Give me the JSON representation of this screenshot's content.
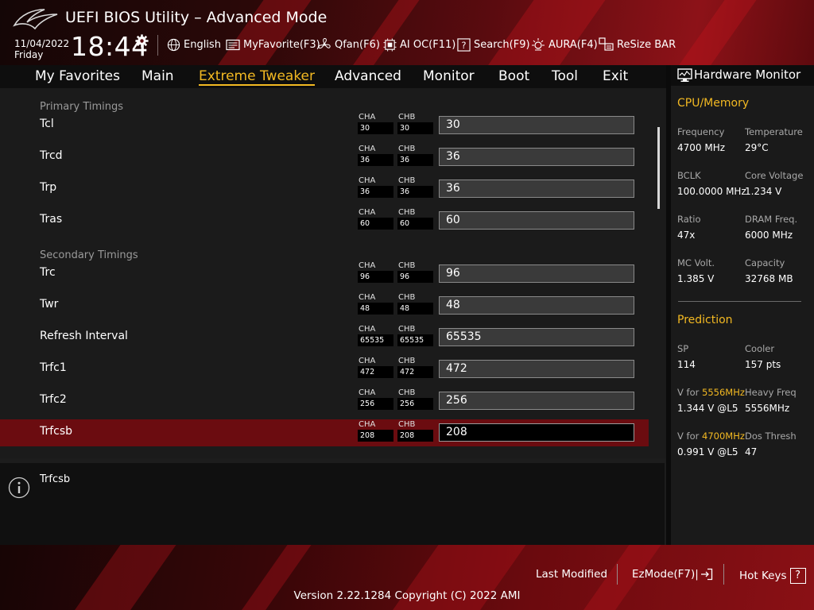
{
  "header": {
    "title": "UEFI BIOS Utility – Advanced Mode",
    "date": "11/04/2022",
    "day": "Friday",
    "time": "18:44",
    "items": [
      {
        "label": "English",
        "icon": "globe-icon"
      },
      {
        "label": "MyFavorite(F3)",
        "icon": "favorite-icon"
      },
      {
        "label": "Qfan(F6)",
        "icon": "fan-icon"
      },
      {
        "label": "AI OC(F11)",
        "icon": "ai-oc-icon"
      },
      {
        "label": "Search(F9)",
        "icon": "search-icon"
      },
      {
        "label": "AURA(F4)",
        "icon": "aura-icon"
      },
      {
        "label": "ReSize BAR",
        "icon": "resize-bar-icon"
      }
    ]
  },
  "tabs": [
    {
      "label": "My Favorites"
    },
    {
      "label": "Main"
    },
    {
      "label": "Extreme Tweaker",
      "active": true
    },
    {
      "label": "Advanced"
    },
    {
      "label": "Monitor"
    },
    {
      "label": "Boot"
    },
    {
      "label": "Tool"
    },
    {
      "label": "Exit"
    }
  ],
  "channel_labels": {
    "a": "CHA",
    "b": "CHB"
  },
  "sections": {
    "primary": "Primary Timings",
    "secondary": "Secondary Timings"
  },
  "rows": [
    {
      "label": "Tcl",
      "cha": "30",
      "chb": "30",
      "value": "30"
    },
    {
      "label": "Trcd",
      "cha": "36",
      "chb": "36",
      "value": "36"
    },
    {
      "label": "Trp",
      "cha": "36",
      "chb": "36",
      "value": "36"
    },
    {
      "label": "Tras",
      "cha": "60",
      "chb": "60",
      "value": "60"
    },
    {
      "label": "Trc",
      "cha": "96",
      "chb": "96",
      "value": "96"
    },
    {
      "label": "Twr",
      "cha": "48",
      "chb": "48",
      "value": "48"
    },
    {
      "label": "Refresh Interval",
      "cha": "65535",
      "chb": "65535",
      "value": "65535"
    },
    {
      "label": "Trfc1",
      "cha": "472",
      "chb": "472",
      "value": "472"
    },
    {
      "label": "Trfc2",
      "cha": "256",
      "chb": "256",
      "value": "256"
    },
    {
      "label": "Trfcsb",
      "cha": "208",
      "chb": "208",
      "value": "208",
      "selected": true
    }
  ],
  "help": {
    "text": "Trfcsb"
  },
  "hardware_monitor": {
    "title": "Hardware Monitor",
    "cpu_memory": {
      "heading": "CPU/Memory",
      "frequency_label": "Frequency",
      "frequency": "4700 MHz",
      "temperature_label": "Temperature",
      "temperature": "29°C",
      "bclk_label": "BCLK",
      "bclk": "100.0000 MHz",
      "core_voltage_label": "Core Voltage",
      "core_voltage": "1.234 V",
      "ratio_label": "Ratio",
      "ratio": "47x",
      "dram_freq_label": "DRAM Freq.",
      "dram_freq": "6000 MHz",
      "mc_volt_label": "MC Volt.",
      "mc_volt": "1.385 V",
      "capacity_label": "Capacity",
      "capacity": "32768 MB"
    },
    "prediction": {
      "heading": "Prediction",
      "sp_label": "SP",
      "sp": "114",
      "cooler_label": "Cooler",
      "cooler": "157 pts",
      "v_for_prefix": "V for ",
      "v_for_1_freq": "5556MHz",
      "v_for_1": "1.344 V @L5",
      "heavy_freq_label": "Heavy Freq",
      "heavy_freq": "5556MHz",
      "v_for_2_freq": "4700MHz",
      "v_for_2": "0.991 V @L5",
      "dos_thresh_label": "Dos Thresh",
      "dos_thresh": "47"
    }
  },
  "footer": {
    "last_modified": "Last Modified",
    "ezmode": "EzMode(F7)|",
    "hot_keys": "Hot Keys",
    "hot_keys_glyph": "?",
    "version": "Version 2.22.1284 Copyright (C) 2022 AMI"
  },
  "colors": {
    "accent": "#f3b922",
    "selected_row": "#6b0c10",
    "panel": "#1d1d1d"
  }
}
